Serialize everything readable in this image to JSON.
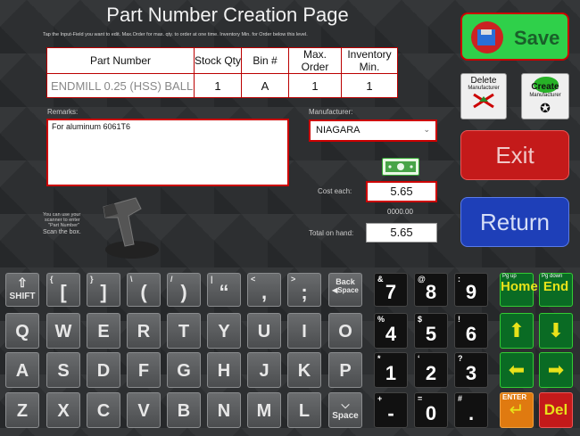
{
  "page": {
    "title": "Part Number Creation Page",
    "subtitle": "Tap the Input-Field you want to edit.   Max.Order for max. qty. to order at one time.   Inventory Min. for Order below this level."
  },
  "table": {
    "headers": [
      "Part Number",
      "Stock Qty",
      "Bin #",
      "Max. Order",
      "Inventory Min."
    ],
    "row": [
      "ENDMILL 0.25 (HSS) BALL",
      "1",
      "A",
      "1",
      "1"
    ]
  },
  "remarks": {
    "label": "Remarks:",
    "value": "For aluminum 6061T6"
  },
  "manufacturer": {
    "label": "Manufacturer:",
    "value": "NIAGARA"
  },
  "cost": {
    "label": "Cost each:",
    "value": "5.65",
    "subvalue": "0000.00"
  },
  "total": {
    "label": "Total on hand:",
    "value": "5.65"
  },
  "scanner_hint": {
    "line1": "You can use your",
    "line2": "scanner to enter",
    "line3": "\"Part Number\"",
    "line4": "Scan the box."
  },
  "buttons": {
    "save": "Save",
    "delete_mfr": "Delete",
    "delete_mfr_sub": "Manufacturer",
    "create_mfr": "Create",
    "create_mfr_sub": "Manufacturer",
    "exit": "Exit",
    "return": "Return"
  },
  "keyboard": {
    "shift": "SHIFT",
    "symbols": [
      {
        "top": "{",
        "main": "["
      },
      {
        "top": "}",
        "main": "]"
      },
      {
        "top": "\\",
        "main": "("
      },
      {
        "top": "/",
        "main": ")"
      },
      {
        "top": "|",
        "main": "“"
      },
      {
        "top": "<",
        "main": ","
      },
      {
        "top": ">",
        "main": ";"
      }
    ],
    "backspace": "Back",
    "backspace_sub": "Space",
    "row_q": [
      "Q",
      "W",
      "E",
      "R",
      "T",
      "Y",
      "U",
      "I",
      "O"
    ],
    "row_a": [
      "A",
      "S",
      "D",
      "F",
      "G",
      "H",
      "J",
      "K",
      "P"
    ],
    "row_z": [
      "Z",
      "X",
      "C",
      "V",
      "B",
      "N",
      "M",
      "L"
    ],
    "space": "Space",
    "numpad": [
      {
        "top": "&",
        "main": "7"
      },
      {
        "top": "@",
        "main": "8"
      },
      {
        "top": ":",
        "main": "9"
      },
      {
        "top": "%",
        "main": "4"
      },
      {
        "top": "$",
        "main": "5"
      },
      {
        "top": "!",
        "main": "6"
      },
      {
        "top": "*",
        "main": "1"
      },
      {
        "top": "‘",
        "main": "2"
      },
      {
        "top": "?",
        "main": "3"
      },
      {
        "top": "+",
        "main": "-"
      },
      {
        "top": "=",
        "main": "0"
      },
      {
        "top": "#",
        "main": "."
      }
    ],
    "pgup": "Pg up",
    "home": "Home",
    "pgdown": "Pg down",
    "end": "End",
    "enter": "ENTER",
    "del": "Del"
  },
  "colors": {
    "accent_red": "#c41a1a",
    "save_green": "#2fd04a",
    "return_blue": "#1e3fb8",
    "nav_green": "#0a6b24",
    "arrow_yellow": "#e8e21a"
  }
}
